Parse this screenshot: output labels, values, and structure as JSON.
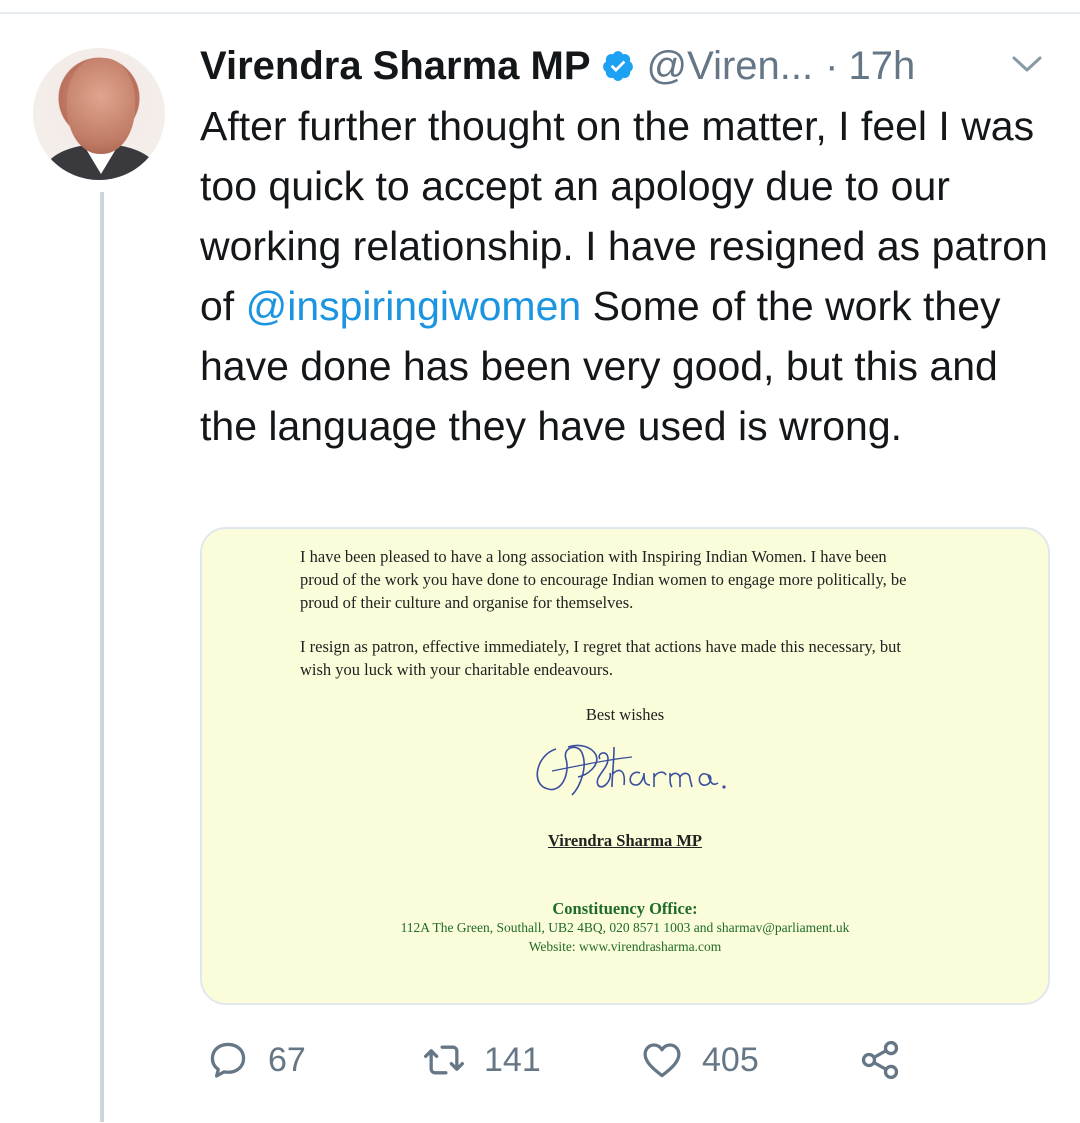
{
  "tweet": {
    "author_name": "Virendra Sharma MP",
    "handle": "@Viren...",
    "separator": "·",
    "time": "17h",
    "text_before_mention": "After further thought on the matter, I feel I was too quick to accept an apology due to our working relationship. I have resigned as patron of ",
    "mention": "@inspiringiwomen",
    "text_after_mention": " Some of the work they have done has been very good, but this and the language they have used is wrong."
  },
  "letter": {
    "paragraph_1": "I have been pleased to have a long association with Inspiring Indian Women. I have been proud of the work you have done to encourage Indian women to engage more politically, be proud of their culture and organise for themselves.",
    "paragraph_2": "I resign as patron, effective immediately, I regret that actions have made this necessary, but wish you luck with your charitable endeavours.",
    "closing": "Best wishes",
    "signature_text": "VSharma.",
    "signer": "Virendra Sharma MP",
    "office_title": "Constituency Office:",
    "office_address": "112A The Green, Southall, UB2 4BQ, 020 8571 1003 and sharmav@parliament.uk",
    "office_website": "Website: www.virendrasharma.com"
  },
  "actions": {
    "replies": "67",
    "retweets": "141",
    "likes": "405"
  },
  "icons": {
    "verified": "verified-badge-icon",
    "menu": "chevron-down-icon",
    "reply": "reply-icon",
    "retweet": "retweet-icon",
    "like": "heart-icon",
    "share": "share-icon"
  },
  "colors": {
    "link": "#1b95e0",
    "verified": "#1da1f2",
    "muted": "#657786",
    "letter_background": "#fbfcda",
    "office_text": "#1f6b2c"
  }
}
